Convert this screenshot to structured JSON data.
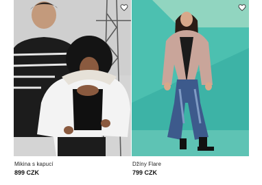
{
  "products": [
    {
      "name": "Mikina s kapucí",
      "price": "899 CZK",
      "wishlist_icon": "heart-icon"
    },
    {
      "name": "Džíny Flare",
      "price": "799 CZK",
      "wishlist_icon": "heart-icon"
    }
  ],
  "colors": {
    "text": "#222222",
    "price": "#111111",
    "image1_bg": "#d9d9d9",
    "image2_bg": "#3fb7a8"
  }
}
